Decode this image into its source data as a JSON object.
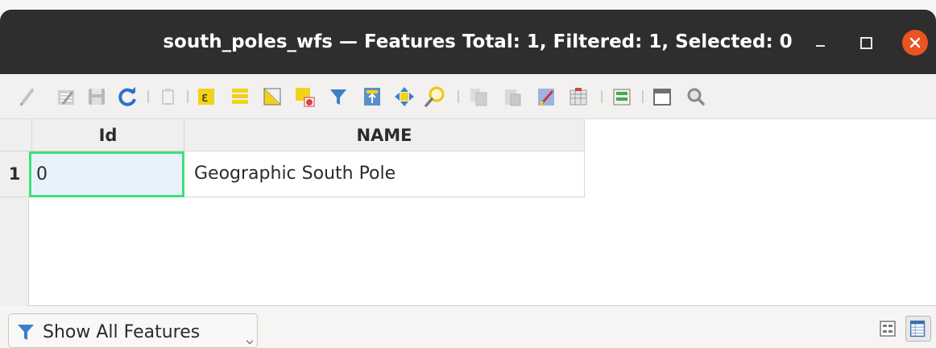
{
  "window": {
    "title": "south_poles_wfs — Features Total: 1, Filtered: 1, Selected: 0"
  },
  "toolbar": {
    "tools": [
      "toggle-editing-icon",
      "toggle-multi-edit-icon",
      "save-edits-icon",
      "reload-table-icon",
      "add-feature-icon",
      "delete-features-icon",
      "select-by-expression-icon",
      "select-all-icon",
      "invert-selection-icon",
      "deselect-all-icon",
      "filter-select-icon",
      "move-selection-to-top-icon",
      "pan-to-selected-icon",
      "zoom-to-selected-icon",
      "copy-features-icon",
      "paste-features-icon",
      "new-field-icon",
      "delete-field-icon",
      "open-field-calculator-icon",
      "conditional-formatting-icon",
      "dock-table-icon",
      "actions-icon"
    ]
  },
  "table": {
    "columns": [
      "Id",
      "NAME"
    ],
    "rows": [
      {
        "row_number": "1",
        "Id": "0",
        "NAME": "Geographic South Pole"
      }
    ],
    "selected_cell": "Id"
  },
  "bottom": {
    "filter_label": "Show All Features",
    "view_modes": [
      "form-view-icon",
      "table-view-icon"
    ],
    "active_view": "table-view-icon"
  }
}
